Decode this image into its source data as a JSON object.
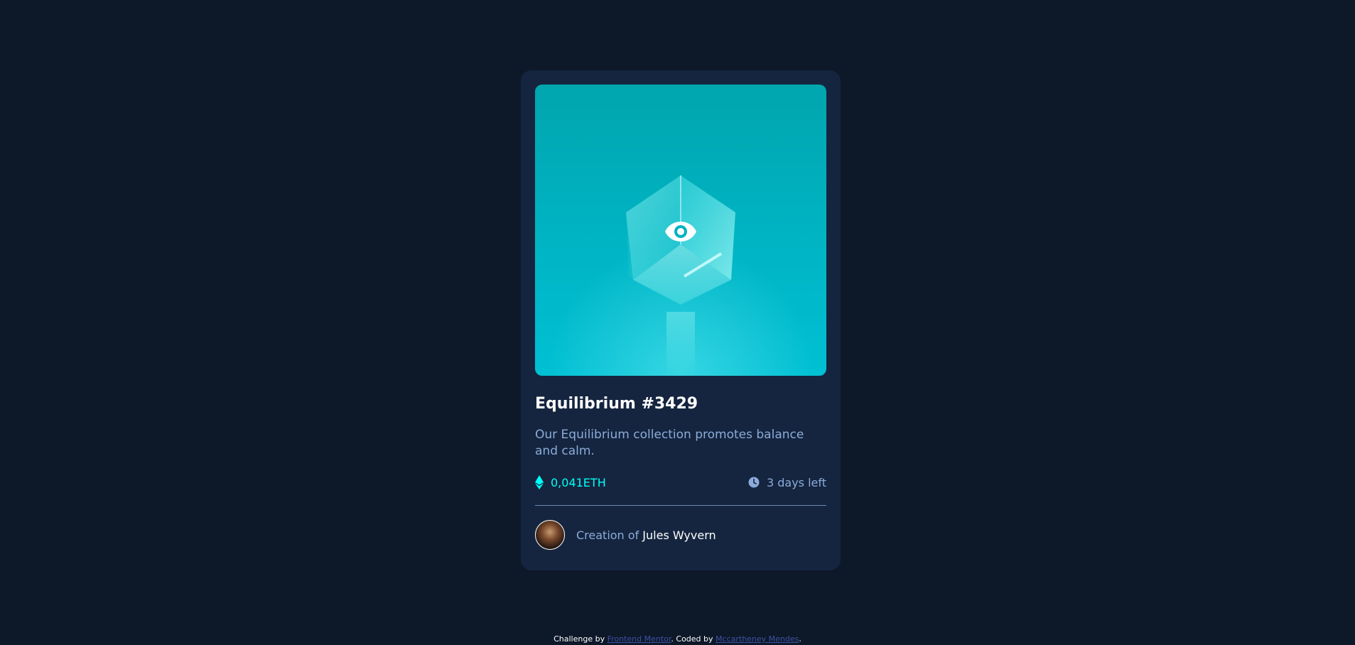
{
  "card": {
    "title": "Equilibrium #3429",
    "description": "Our Equilibrium collection promotes balance and calm.",
    "price": "0,041ETH",
    "time_left": "3 days left",
    "creator_prefix": "Creation of",
    "creator_name": "Jules Wyvern",
    "icons": {
      "hero_overlay": "eye-icon",
      "price": "ethereum-icon",
      "time": "clock-icon",
      "creator": "avatar"
    }
  },
  "attribution": {
    "challenge_prefix": "Challenge by",
    "challenge_link": "Frontend Mentor",
    "coded_prefix": ". Coded by",
    "coded_link": "Mccartheney Mendes",
    "suffix": "."
  },
  "colors": {
    "background": "#0d1829",
    "card": "#15253f",
    "accent_cyan": "#00fff8",
    "soft_blue": "#8bacd9",
    "white": "#ffffff"
  }
}
